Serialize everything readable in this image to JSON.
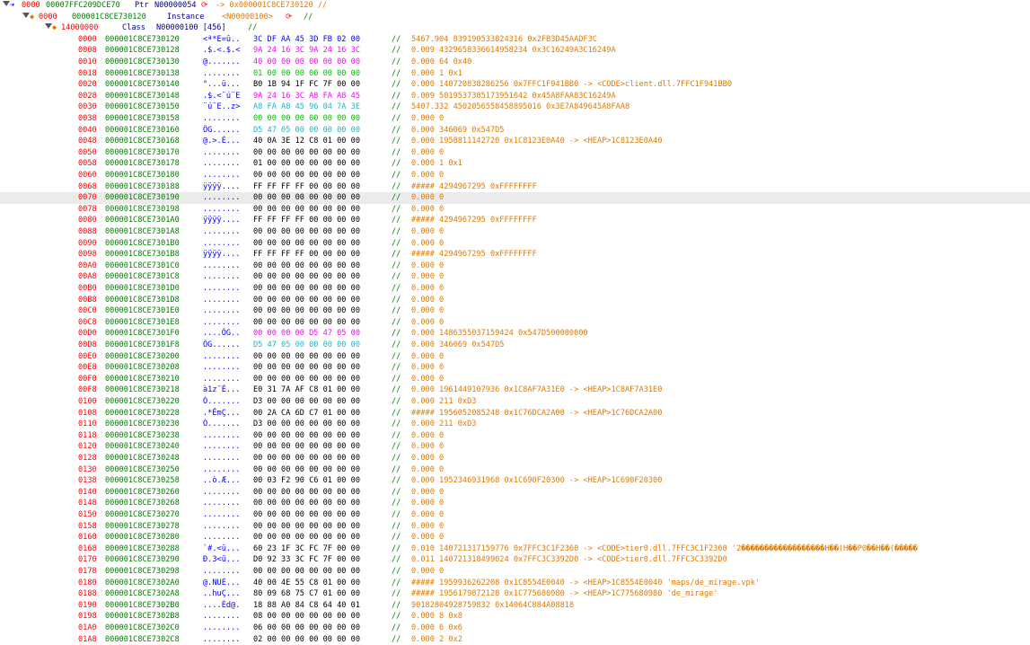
{
  "header_rows": [
    {
      "prefix": "0000",
      "addr": "00007FFC209DCE70",
      "kind": "Ptr",
      "name": "N00000054",
      "tail": "-> 0x000001C8CE730120 //"
    },
    {
      "prefix": "0000",
      "addr": "000001C8CE730120",
      "kind": "Instance",
      "name": "<N00000100>",
      "tail": "//"
    },
    {
      "prefix": "14000000",
      "addr": "",
      "kind": "Class",
      "name": "N00000100 [456]",
      "tail": "//"
    }
  ],
  "rows": [
    {
      "off": "0000",
      "addr": "000001C8CE730120",
      "ascii": "<ª*E=û..",
      "hex": "3C DF AA 45 3D FB 02 00",
      "hc": "blue",
      "info": "5467.904 839190533824316 0x2FB3D45AADF3C"
    },
    {
      "off": "0008",
      "addr": "000001C8CE730128",
      "ascii": ".$.<.$.<",
      "hex": "9A 24 16 3C 9A 24 16 3C",
      "hc": "pink",
      "info": "0.009 4329658336614958234 0x3C16249A3C16249A"
    },
    {
      "off": "0010",
      "addr": "000001C8CE730130",
      "ascii": "@.......",
      "hex": "40 00 00 00 00 00 00 00",
      "hc": "pink",
      "info": "0.000 64 0x40"
    },
    {
      "off": "0018",
      "addr": "000001C8CE730138",
      "ascii": "........",
      "hex": "01 00 00 00 00 00 00 00",
      "hc": "green",
      "info": "0.000 1 0x1"
    },
    {
      "off": "0020",
      "addr": "000001C8CE730140",
      "ascii": "°...ü...",
      "hex": "B0 1B 94 1F FC 7F 00 00",
      "hc": "black",
      "info": "0.000 140720838286256 0x7FFC1F941BB0 -> <CODE>client.dll.7FFC1F941BB0"
    },
    {
      "off": "0028",
      "addr": "000001C8CE730148",
      "ascii": ".$.<¨ú¨E",
      "hex": "9A 24 16 3C A8 FA A8 45",
      "hc": "pink",
      "info": "0.009 5019537385173951642 0x45A8FAA83C16249A"
    },
    {
      "off": "0030",
      "addr": "000001C8CE730150",
      "ascii": "¨ú¨E..z>",
      "hex": "A8 FA A8 45 96 04 7A 3E",
      "hc": "cyan",
      "info": "5407.332 4502056558458895016 0x3E7A849645A8FAA8"
    },
    {
      "off": "0038",
      "addr": "000001C8CE730158",
      "ascii": "........",
      "hex": "00 00 00 00 00 00 00 00",
      "hc": "green",
      "info": "0.000 0"
    },
    {
      "off": "0040",
      "addr": "000001C8CE730160",
      "ascii": "ÕG......",
      "hex": "D5 47 05 00 00 00 00 00",
      "hc": "cyan",
      "info": "0.000 346069 0x547D5"
    },
    {
      "off": "0048",
      "addr": "000001C8CE730168",
      "ascii": "@.>.È...",
      "hex": "40 0A 3E 12 C8 01 00 00",
      "hc": "black",
      "info": "0.000 1958811142720 0x1C8123E0A40 -> <HEAP>1C8123E0A40"
    },
    {
      "off": "0050",
      "addr": "000001C8CE730170",
      "ascii": "........",
      "hex": "00 00 00 00 00 00 00 00",
      "hc": "black",
      "info": "0.000 0"
    },
    {
      "off": "0058",
      "addr": "000001C8CE730178",
      "ascii": "........",
      "hex": "01 00 00 00 00 00 00 00",
      "hc": "black",
      "info": "0.000 1 0x1"
    },
    {
      "off": "0060",
      "addr": "000001C8CE730180",
      "ascii": "........",
      "hex": "00 00 00 00 00 00 00 00",
      "hc": "black",
      "info": "0.000 0"
    },
    {
      "off": "0068",
      "addr": "000001C8CE730188",
      "ascii": "ÿÿÿÿ....",
      "hex": "FF FF FF FF 00 00 00 00",
      "hc": "black",
      "info": "##### 4294967295 0xFFFFFFFF"
    },
    {
      "off": "0070",
      "addr": "000001C8CE730190",
      "ascii": "........",
      "hex": "00 00 00 00 00 00 00 00",
      "hc": "black",
      "info": "0.000 0"
    },
    {
      "off": "0078",
      "addr": "000001C8CE730198",
      "ascii": "........",
      "hex": "00 00 00 00 00 00 00 00",
      "hc": "black",
      "info": "0.000 0"
    },
    {
      "off": "0080",
      "addr": "000001C8CE7301A0",
      "ascii": "ÿÿÿÿ....",
      "hex": "FF FF FF FF 00 00 00 00",
      "hc": "black",
      "info": "##### 4294967295 0xFFFFFFFF"
    },
    {
      "off": "0088",
      "addr": "000001C8CE7301A8",
      "ascii": "........",
      "hex": "00 00 00 00 00 00 00 00",
      "hc": "black",
      "info": "0.000 0"
    },
    {
      "off": "0090",
      "addr": "000001C8CE7301B0",
      "ascii": "........",
      "hex": "00 00 00 00 00 00 00 00",
      "hc": "black",
      "info": "0.000 0"
    },
    {
      "off": "0098",
      "addr": "000001C8CE7301B8",
      "ascii": "ÿÿÿÿ....",
      "hex": "FF FF FF FF 00 00 00 00",
      "hc": "black",
      "info": "##### 4294967295 0xFFFFFFFF"
    },
    {
      "off": "00A0",
      "addr": "000001C8CE7301C0",
      "ascii": "........",
      "hex": "00 00 00 00 00 00 00 00",
      "hc": "black",
      "info": "0.000 0"
    },
    {
      "off": "00A8",
      "addr": "000001C8CE7301C8",
      "ascii": "........",
      "hex": "00 00 00 00 00 00 00 00",
      "hc": "black",
      "info": "0.000 0"
    },
    {
      "off": "00B0",
      "addr": "000001C8CE7301D0",
      "ascii": "........",
      "hex": "00 00 00 00 00 00 00 00",
      "hc": "black",
      "info": "0.000 0"
    },
    {
      "off": "00B8",
      "addr": "000001C8CE7301D8",
      "ascii": "........",
      "hex": "00 00 00 00 00 00 00 00",
      "hc": "black",
      "info": "0.000 0"
    },
    {
      "off": "00C0",
      "addr": "000001C8CE7301E0",
      "ascii": "........",
      "hex": "00 00 00 00 00 00 00 00",
      "hc": "black",
      "info": "0.000 0"
    },
    {
      "off": "00C8",
      "addr": "000001C8CE7301E8",
      "ascii": "........",
      "hex": "00 00 00 00 00 00 00 00",
      "hc": "black",
      "info": "0.000 0"
    },
    {
      "off": "00D0",
      "addr": "000001C8CE7301F0",
      "ascii": "....ÕG..",
      "hex": "00 00 00 00 D5 47 05 00",
      "hc": "pink",
      "info": "0.000 1486355037159424 0x547D500000000"
    },
    {
      "off": "00D8",
      "addr": "000001C8CE7301F8",
      "ascii": "ÕG......",
      "hex": "D5 47 05 00 00 00 00 00",
      "hc": "cyan",
      "info": "0.000 346069 0x547D5"
    },
    {
      "off": "00E0",
      "addr": "000001C8CE730200",
      "ascii": "........",
      "hex": "00 00 00 00 00 00 00 00",
      "hc": "black",
      "info": "0.000 0"
    },
    {
      "off": "00E8",
      "addr": "000001C8CE730208",
      "ascii": "........",
      "hex": "00 00 00 00 00 00 00 00",
      "hc": "black",
      "info": "0.000 0"
    },
    {
      "off": "00F0",
      "addr": "000001C8CE730210",
      "ascii": "........",
      "hex": "00 00 00 00 00 00 00 00",
      "hc": "black",
      "info": "0.000 0"
    },
    {
      "off": "00F8",
      "addr": "000001C8CE730218",
      "ascii": "à1z¯È...",
      "hex": "E0 31 7A AF C8 01 00 00",
      "hc": "black",
      "info": "0.000 1961449107936 0x1C8AF7A31E0 -> <HEAP>1C8AF7A31E0"
    },
    {
      "off": "0100",
      "addr": "000001C8CE730220",
      "ascii": "Ó.......",
      "hex": "D3 00 00 00 00 00 00 00",
      "hc": "black",
      "info": "0.000 211 0xD3"
    },
    {
      "off": "0108",
      "addr": "000001C8CE730228",
      "ascii": ".*ÊmÇ...",
      "hex": "00 2A CA 6D C7 01 00 00",
      "hc": "black",
      "info": "##### 1956052085248 0x1C76DCA2A00 -> <HEAP>1C76DCA2A00"
    },
    {
      "off": "0110",
      "addr": "000001C8CE730230",
      "ascii": "Ó.......",
      "hex": "D3 00 00 00 00 00 00 00",
      "hc": "black",
      "info": "0.000 211 0xD3"
    },
    {
      "off": "0118",
      "addr": "000001C8CE730238",
      "ascii": "........",
      "hex": "00 00 00 00 00 00 00 00",
      "hc": "black",
      "info": "0.000 0"
    },
    {
      "off": "0120",
      "addr": "000001C8CE730240",
      "ascii": "........",
      "hex": "00 00 00 00 00 00 00 00",
      "hc": "black",
      "info": "0.000 0"
    },
    {
      "off": "0128",
      "addr": "000001C8CE730248",
      "ascii": "........",
      "hex": "00 00 00 00 00 00 00 00",
      "hc": "black",
      "info": "0.000 0"
    },
    {
      "off": "0130",
      "addr": "000001C8CE730250",
      "ascii": "........",
      "hex": "00 00 00 00 00 00 00 00",
      "hc": "black",
      "info": "0.000 0"
    },
    {
      "off": "0138",
      "addr": "000001C8CE730258",
      "ascii": "..ò.Æ...",
      "hex": "00 03 F2 90 C6 01 00 00",
      "hc": "black",
      "info": "0.000 1952346931968 0x1C690F20300 -> <HEAP>1C690F20300"
    },
    {
      "off": "0140",
      "addr": "000001C8CE730260",
      "ascii": "........",
      "hex": "00 00 00 00 00 00 00 00",
      "hc": "black",
      "info": "0.000 0"
    },
    {
      "off": "0148",
      "addr": "000001C8CE730268",
      "ascii": "........",
      "hex": "00 00 00 00 00 00 00 00",
      "hc": "black",
      "info": "0.000 0"
    },
    {
      "off": "0150",
      "addr": "000001C8CE730270",
      "ascii": "........",
      "hex": "00 00 00 00 00 00 00 00",
      "hc": "black",
      "info": "0.000 0"
    },
    {
      "off": "0158",
      "addr": "000001C8CE730278",
      "ascii": "........",
      "hex": "00 00 00 00 00 00 00 00",
      "hc": "black",
      "info": "0.000 0"
    },
    {
      "off": "0160",
      "addr": "000001C8CE730280",
      "ascii": "........",
      "hex": "00 00 00 00 00 00 00 00",
      "hc": "black",
      "info": "0.000 0"
    },
    {
      "off": "0168",
      "addr": "000001C8CE730288",
      "ascii": "`#.<ü...",
      "hex": "60 23 1F 3C FC 7F 00 00",
      "hc": "black",
      "info": "0.010 140721317159776 0x7FFC3C1F2360 -> <CODE>tier0.dll.7FFC3C1F2360 '2������������������H��(H��P0��H��(�����"
    },
    {
      "off": "0170",
      "addr": "000001C8CE730290",
      "ascii": "Ð.3<ü...",
      "hex": "D0 92 33 3C FC 7F 00 00",
      "hc": "black",
      "info": "0.011 140721318499024 0x7FFC3C3392D0 -> <CODE>tier0.dll.7FFC3C3392D0"
    },
    {
      "off": "0178",
      "addr": "000001C8CE730298",
      "ascii": "........",
      "hex": "00 00 00 00 00 00 00 00",
      "hc": "black",
      "info": "0.000 0"
    },
    {
      "off": "0180",
      "addr": "000001C8CE7302A0",
      "ascii": "@.NUÈ...",
      "hex": "40 00 4E 55 C8 01 00 00",
      "hc": "black",
      "info": "##### 1959936262208 0x1C8554E0040 -> <HEAP>1C8554E0040 'maps/de_mirage.vpk'"
    },
    {
      "off": "0188",
      "addr": "000001C8CE7302A8",
      "ascii": "..huÇ...",
      "hex": "80 09 68 75 C7 01 00 00",
      "hc": "black",
      "info": "##### 1956179872128 0x1C775680980 -> <HEAP>1C775680980 'de_mirage'"
    },
    {
      "off": "0190",
      "addr": "000001C8CE7302B0",
      "ascii": "....Èd@.",
      "hex": "18 88 A0 84 C8 64 40 01",
      "hc": "black",
      "info": "90182804928759832 0x14064C884A08818"
    },
    {
      "off": "0198",
      "addr": "000001C8CE7302B8",
      "ascii": "........",
      "hex": "08 00 00 00 00 00 00 00",
      "hc": "black",
      "info": "0.000 8 0x8"
    },
    {
      "off": "01A0",
      "addr": "000001C8CE7302C0",
      "ascii": "........",
      "hex": "06 00 00 00 00 00 00 00",
      "hc": "black",
      "info": "0.000 6 0x6"
    },
    {
      "off": "01A8",
      "addr": "000001C8CE7302C8",
      "ascii": "........",
      "hex": "02 00 00 00 00 00 00 00",
      "hc": "black",
      "info": "0.000 2 0x2"
    }
  ],
  "selected_row_index": 14,
  "colors": {
    "offset": "#ff0000",
    "address": "#008000",
    "ascii": "#0000ff",
    "info": "#e07a00",
    "selection": "#ebebeb"
  }
}
